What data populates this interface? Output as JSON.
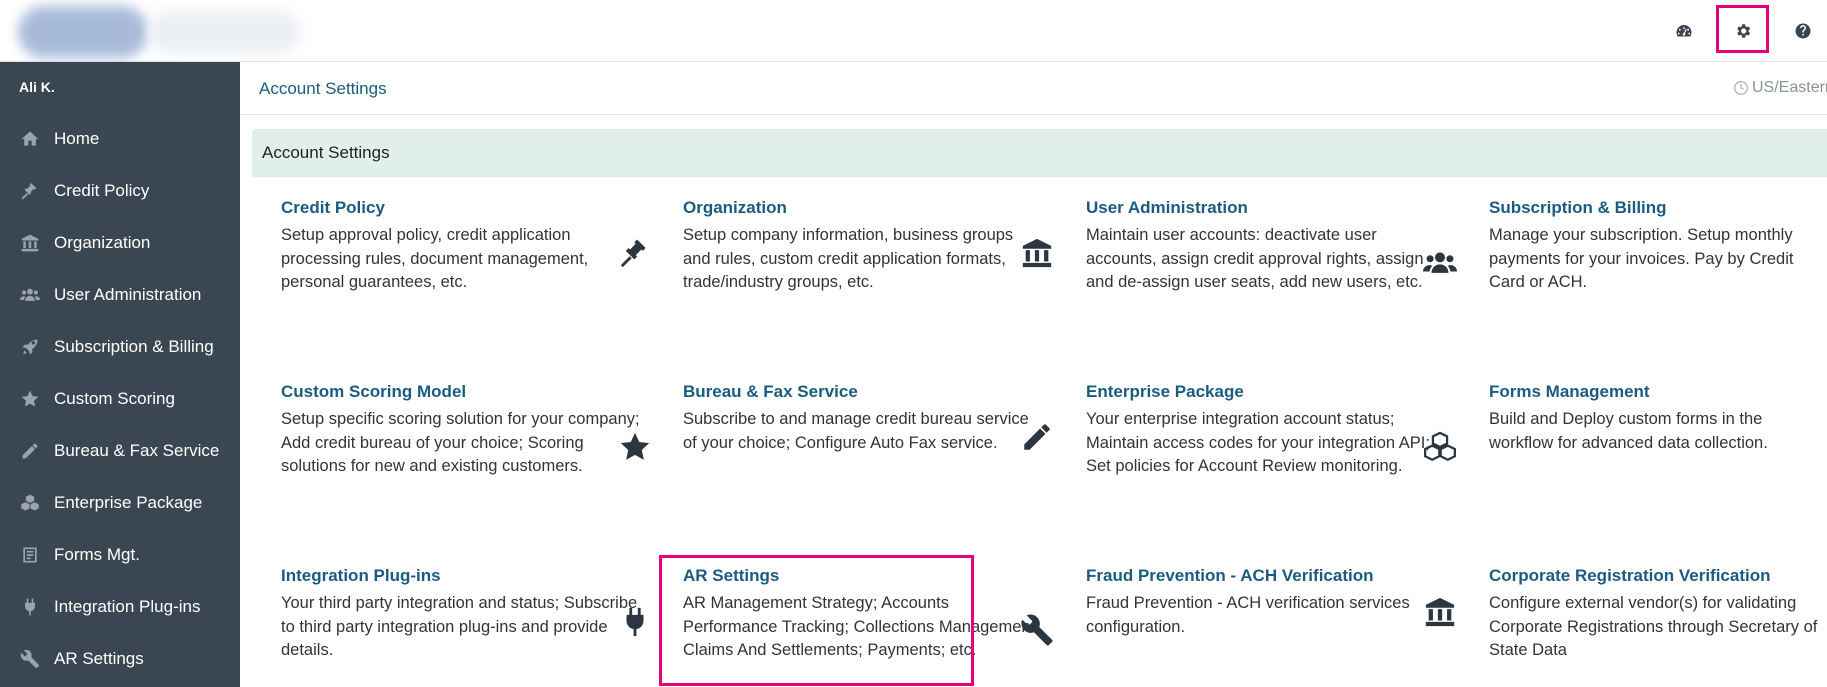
{
  "topbar": {
    "icons": [
      "dashboard-icon",
      "gear-icon",
      "help-icon"
    ]
  },
  "sidebar": {
    "user_name": "Ali K.",
    "items": [
      {
        "label": "Home",
        "icon": "home-icon"
      },
      {
        "label": "Credit Policy",
        "icon": "gavel-icon"
      },
      {
        "label": "Organization",
        "icon": "bank-icon"
      },
      {
        "label": "User Administration",
        "icon": "users-icon"
      },
      {
        "label": "Subscription & Billing",
        "icon": "rocket-icon"
      },
      {
        "label": "Custom Scoring",
        "icon": "star-icon"
      },
      {
        "label": "Bureau & Fax Service",
        "icon": "pencil-icon"
      },
      {
        "label": "Enterprise Package",
        "icon": "cubes-icon"
      },
      {
        "label": "Forms Mgt.",
        "icon": "form-icon"
      },
      {
        "label": "Integration Plug-ins",
        "icon": "plug-icon"
      },
      {
        "label": "AR Settings",
        "icon": "wrench-icon"
      }
    ]
  },
  "main": {
    "breadcrumb": "Account Settings",
    "timezone": "US/Eastern",
    "panel_title": "Account Settings",
    "cards": [
      {
        "title": "Credit Policy",
        "desc": "Setup approval policy, credit application processing rules, document management, personal guarantees, etc.",
        "icon": "gavel-icon"
      },
      {
        "title": "Organization",
        "desc": "Setup company information, business groups and rules, custom credit application formats, trade/industry groups, etc.",
        "icon": "bank-icon"
      },
      {
        "title": "User Administration",
        "desc": "Maintain user accounts: deactivate user accounts, assign credit approval rights, assign and de-assign user seats, add new users, etc.",
        "icon": "users-icon"
      },
      {
        "title": "Subscription & Billing",
        "desc": "Manage your subscription. Setup monthly payments for your invoices. Pay by Credit Card or ACH.",
        "icon": ""
      },
      {
        "title": "Custom Scoring Model",
        "desc": "Setup specific scoring solution for your company; Add credit bureau of your choice; Scoring solutions for new and existing customers.",
        "icon": "star-icon"
      },
      {
        "title": "Bureau & Fax Service",
        "desc": "Subscribe to and manage credit bureau service of your choice; Configure Auto Fax service.",
        "icon": "pencil-icon"
      },
      {
        "title": "Enterprise Package",
        "desc": "Your enterprise integration account status; Maintain access codes for your integration API; Set policies for Account Review monitoring.",
        "icon": "cubes-icon"
      },
      {
        "title": "Forms Management",
        "desc": "Build and Deploy custom forms in the workflow for advanced data collection.",
        "icon": ""
      },
      {
        "title": "Integration Plug-ins",
        "desc": "Your third party integration and status; Subscribe to third party integration plug-ins and provide details.",
        "icon": "plug-icon"
      },
      {
        "title": "AR Settings",
        "desc": "AR Management Strategy; Accounts Performance Tracking; Collections Management; Claims And Settlements; Payments; etc.",
        "icon": "wrench-icon"
      },
      {
        "title": "Fraud Prevention - ACH Verification",
        "desc": "Fraud Prevention - ACH verification services configuration.",
        "icon": "bank-icon"
      },
      {
        "title": "Corporate Registration Verification",
        "desc": "Configure external vendor(s) for validating Corporate Registrations through Secretary of State Data",
        "icon": ""
      }
    ]
  },
  "colors": {
    "sidebar_bg": "#3a4651",
    "link": "#1a5c80",
    "panel_header_bg": "#e1efea",
    "highlight": "#e4007c"
  }
}
